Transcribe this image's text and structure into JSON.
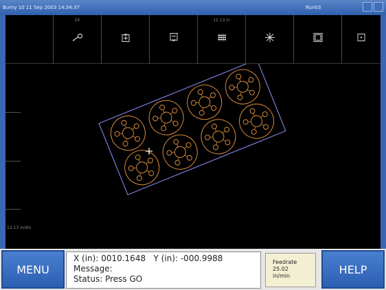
{
  "titlebar": {
    "left_text": "Burny 10    11 Sep 2003  14:34:37",
    "right_text": "Run03"
  },
  "toolbar": {
    "tools": [
      {
        "name": "blank-tool",
        "caption": "",
        "icon": ""
      },
      {
        "name": "zoom-tool",
        "caption": "2X",
        "icon": "magnifier-icon"
      },
      {
        "name": "nest-up-tool",
        "caption": "",
        "icon": "box-up-icon"
      },
      {
        "name": "nest-down-tool",
        "caption": "",
        "icon": "box-down-icon"
      },
      {
        "name": "grid-tool",
        "caption": "12.13 in",
        "icon": "grid-icon"
      },
      {
        "name": "fit-tool",
        "caption": "",
        "icon": "star-icon"
      },
      {
        "name": "window-tool",
        "caption": "",
        "icon": "square-icon"
      },
      {
        "name": "center-tool",
        "caption": "",
        "icon": "dot-square-icon"
      }
    ]
  },
  "viewport": {
    "scale_label": "12.13 in/div",
    "plate_color": "#7b7bd6",
    "part_color": "#d98a3a"
  },
  "bottom": {
    "menu_label": "MENU",
    "help_label": "HELP",
    "x_label": "X (in): 0010.1648",
    "y_label": "Y (in): -000.9988",
    "message_label": "Message:",
    "status_label": "Status:  Press GO",
    "feed_title": "Feedrate",
    "feed_value": "25.02",
    "feed_unit": "in/min"
  }
}
